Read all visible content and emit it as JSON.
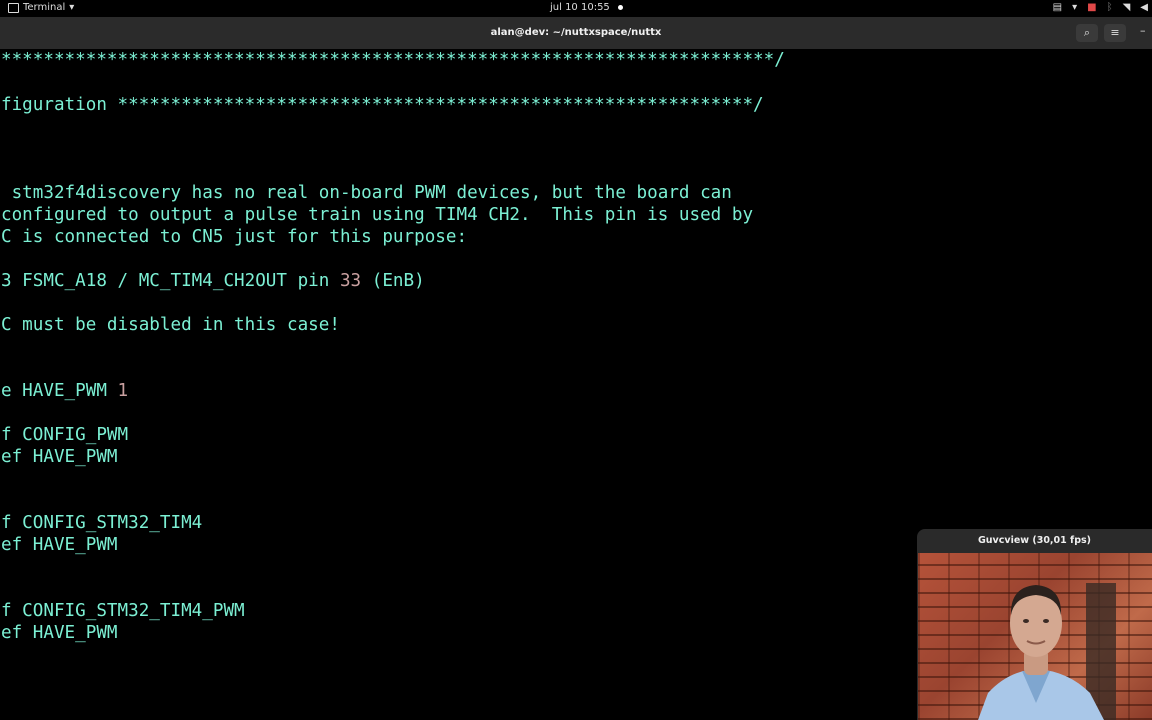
{
  "topbar": {
    "app_name": "Terminal",
    "clock": "jul 10  10:55"
  },
  "window": {
    "title": "alan@dev: ~/nuttxspace/nuttx"
  },
  "terminal": {
    "lines": [
      {
        "text": "*************************************************************************/",
        "parts": []
      },
      {
        "text": "figuration ************************************************************/"
      },
      {
        "text": " stm32f4discovery has no real on-board PWM devices, but the board can"
      },
      {
        "text": "configured to output a pulse train using TIM4 CH2.  This pin is used by"
      },
      {
        "text": "C is connected to CN5 just for this purpose:"
      },
      {
        "pre": "3 FSMC_A18 / MC_TIM4_CH2OUT pin ",
        "num": "33",
        "post": " (EnB)"
      },
      {
        "text": "C must be disabled in this case!"
      },
      {
        "pre": "e HAVE_PWM ",
        "num": "1",
        "post": ""
      },
      {
        "text": "f CONFIG_PWM"
      },
      {
        "text": "ef HAVE_PWM"
      },
      {
        "text": "f CONFIG_STM32_TIM4"
      },
      {
        "text": "ef HAVE_PWM"
      },
      {
        "text": "f CONFIG_STM32_TIM4_PWM"
      },
      {
        "text": "ef HAVE_PWM"
      }
    ]
  },
  "guvcview": {
    "title": "Guvcview  (30,01 fps)"
  },
  "colors": {
    "terminal_fg": "#7cf0d4",
    "number_fg": "#c9a0a0",
    "header_bg": "#2b2b2b"
  }
}
